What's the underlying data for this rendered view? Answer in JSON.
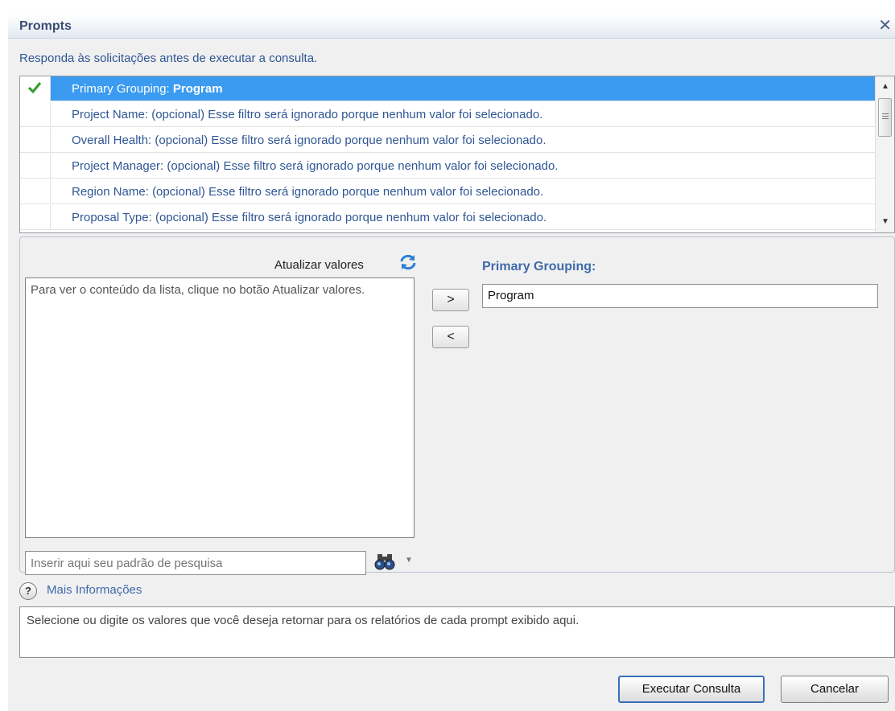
{
  "window": {
    "title": "Prompts",
    "close_glyph": "✕"
  },
  "instruction": "Responda às solicitações antes de executar a consulta.",
  "prompts": [
    {
      "label": "Primary Grouping:",
      "value": "Program",
      "checked": true,
      "selected": true
    },
    {
      "label": "Project Name:",
      "status": "(opcional) Esse filtro será ignorado porque nenhum valor foi selecionado."
    },
    {
      "label": "Overall Health:",
      "status": "(opcional) Esse filtro será ignorado porque nenhum valor foi selecionado."
    },
    {
      "label": "Project Manager:",
      "status": "(opcional) Esse filtro será ignorado porque nenhum valor foi selecionado."
    },
    {
      "label": "Region Name:",
      "status": "(opcional) Esse filtro será ignorado porque nenhum valor foi selecionado."
    },
    {
      "label": "Proposal Type:",
      "status": "(opcional) Esse filtro será ignorado porque nenhum valor foi selecionado."
    }
  ],
  "values_panel": {
    "refresh_label": "Atualizar valores",
    "list_message": "Para ver o conteúdo da lista, clique no botão Atualizar valores.",
    "search_placeholder": "Inserir aqui seu padrão de pesquisa",
    "add_label": ">",
    "remove_label": "<"
  },
  "selection": {
    "label": "Primary Grouping:",
    "value": "Program"
  },
  "more_info": {
    "icon_glyph": "?",
    "link": "Mais Informações",
    "text": "Selecione ou digite os valores que você deseja retornar para os relatórios de cada prompt exibido aqui."
  },
  "buttons": {
    "run": "Executar Consulta",
    "cancel": "Cancelar"
  },
  "colors": {
    "selected_row": "#3a9bf0",
    "link": "#2f5694",
    "check": "#2e9e2e"
  }
}
